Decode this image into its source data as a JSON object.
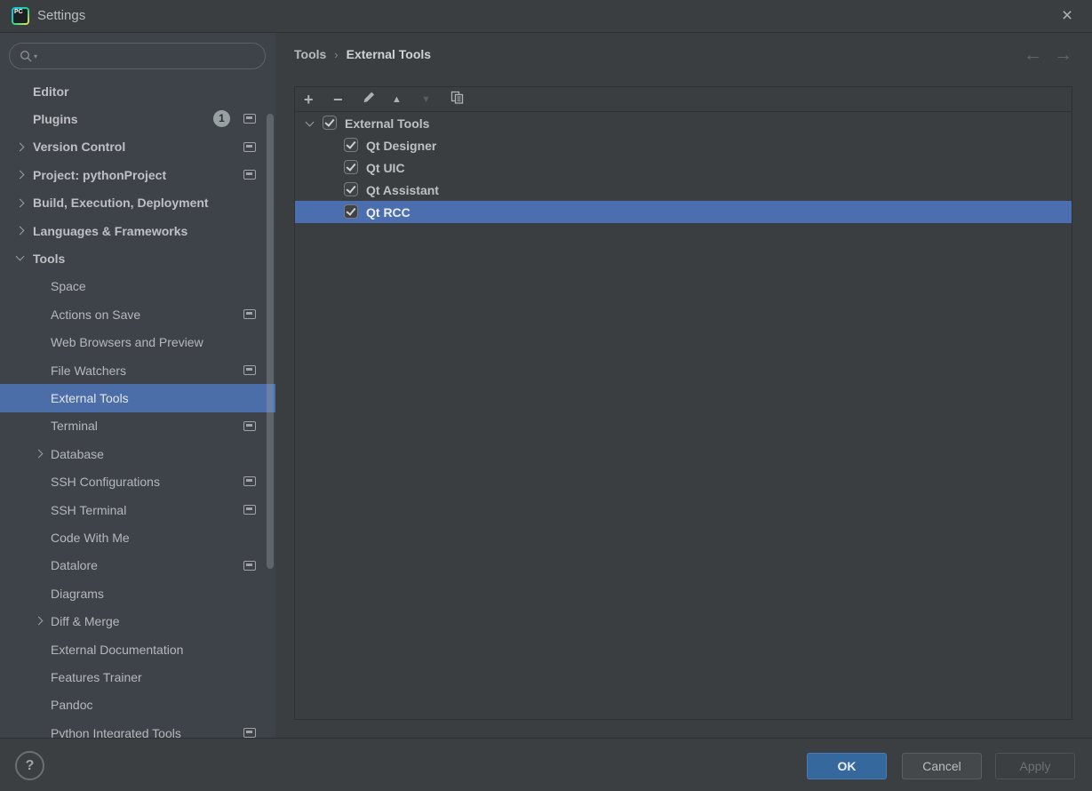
{
  "window": {
    "title": "Settings"
  },
  "titlebar": {
    "app_icon_text": "PC",
    "close_icon": "×"
  },
  "search": {
    "placeholder": "",
    "value": ""
  },
  "sidebar": {
    "items": [
      {
        "label": "Editor",
        "level": 0
      },
      {
        "label": "Plugins",
        "level": 0,
        "badge": "1",
        "modified": true
      },
      {
        "label": "Version Control",
        "level": 0,
        "chevron": "collapsed",
        "modified": true
      },
      {
        "label": "Project: pythonProject",
        "level": 0,
        "chevron": "collapsed",
        "modified": true
      },
      {
        "label": "Build, Execution, Deployment",
        "level": 0,
        "chevron": "collapsed"
      },
      {
        "label": "Languages & Frameworks",
        "level": 0,
        "chevron": "collapsed"
      },
      {
        "label": "Tools",
        "level": 0,
        "chevron": "expanded"
      },
      {
        "label": "Space",
        "level": 1
      },
      {
        "label": "Actions on Save",
        "level": 1,
        "modified": true
      },
      {
        "label": "Web Browsers and Preview",
        "level": 1
      },
      {
        "label": "File Watchers",
        "level": 1,
        "modified": true
      },
      {
        "label": "External Tools",
        "level": 1,
        "selected": true
      },
      {
        "label": "Terminal",
        "level": 1,
        "modified": true
      },
      {
        "label": "Database",
        "level": 1,
        "chevron": "collapsed"
      },
      {
        "label": "SSH Configurations",
        "level": 1,
        "modified": true
      },
      {
        "label": "SSH Terminal",
        "level": 1,
        "modified": true
      },
      {
        "label": "Code With Me",
        "level": 1
      },
      {
        "label": "Datalore",
        "level": 1,
        "modified": true
      },
      {
        "label": "Diagrams",
        "level": 1
      },
      {
        "label": "Diff & Merge",
        "level": 1,
        "chevron": "collapsed"
      },
      {
        "label": "External Documentation",
        "level": 1
      },
      {
        "label": "Features Trainer",
        "level": 1
      },
      {
        "label": "Pandoc",
        "level": 1
      },
      {
        "label": "Python Integrated Tools",
        "level": 1,
        "modified": true
      }
    ]
  },
  "breadcrumb": {
    "items": [
      "Tools",
      "External Tools"
    ],
    "separator": "›"
  },
  "toolbar": {
    "buttons": [
      {
        "name": "add",
        "glyph": "+",
        "enabled": true
      },
      {
        "name": "remove",
        "glyph": "−",
        "enabled": true
      },
      {
        "name": "edit",
        "glyph": "pencil",
        "enabled": true
      },
      {
        "name": "move-up",
        "glyph": "▲",
        "enabled": true
      },
      {
        "name": "move-down",
        "glyph": "▼",
        "enabled": false
      },
      {
        "name": "copy",
        "glyph": "duplicate",
        "enabled": true
      }
    ]
  },
  "tree": {
    "items": [
      {
        "label": "External Tools",
        "level": 0,
        "checked": true,
        "expanded": true
      },
      {
        "label": "Qt Designer",
        "level": 1,
        "checked": true
      },
      {
        "label": "Qt UIC",
        "level": 1,
        "checked": true
      },
      {
        "label": "Qt Assistant",
        "level": 1,
        "checked": true
      },
      {
        "label": "Qt RCC",
        "level": 1,
        "checked": true,
        "selected": true
      }
    ]
  },
  "footer": {
    "help_label": "?",
    "buttons": [
      {
        "label": "OK",
        "primary": true,
        "enabled": true
      },
      {
        "label": "Cancel",
        "enabled": true
      },
      {
        "label": "Apply",
        "enabled": false
      }
    ]
  },
  "colors": {
    "background": "#3c3f41",
    "sidebar_background": "#3e434a",
    "tree_selection": "#4b6eaf",
    "sidebar_selection": "#4b6da8",
    "primary_button": "#35699e",
    "badge_background": "#98a0a3"
  }
}
